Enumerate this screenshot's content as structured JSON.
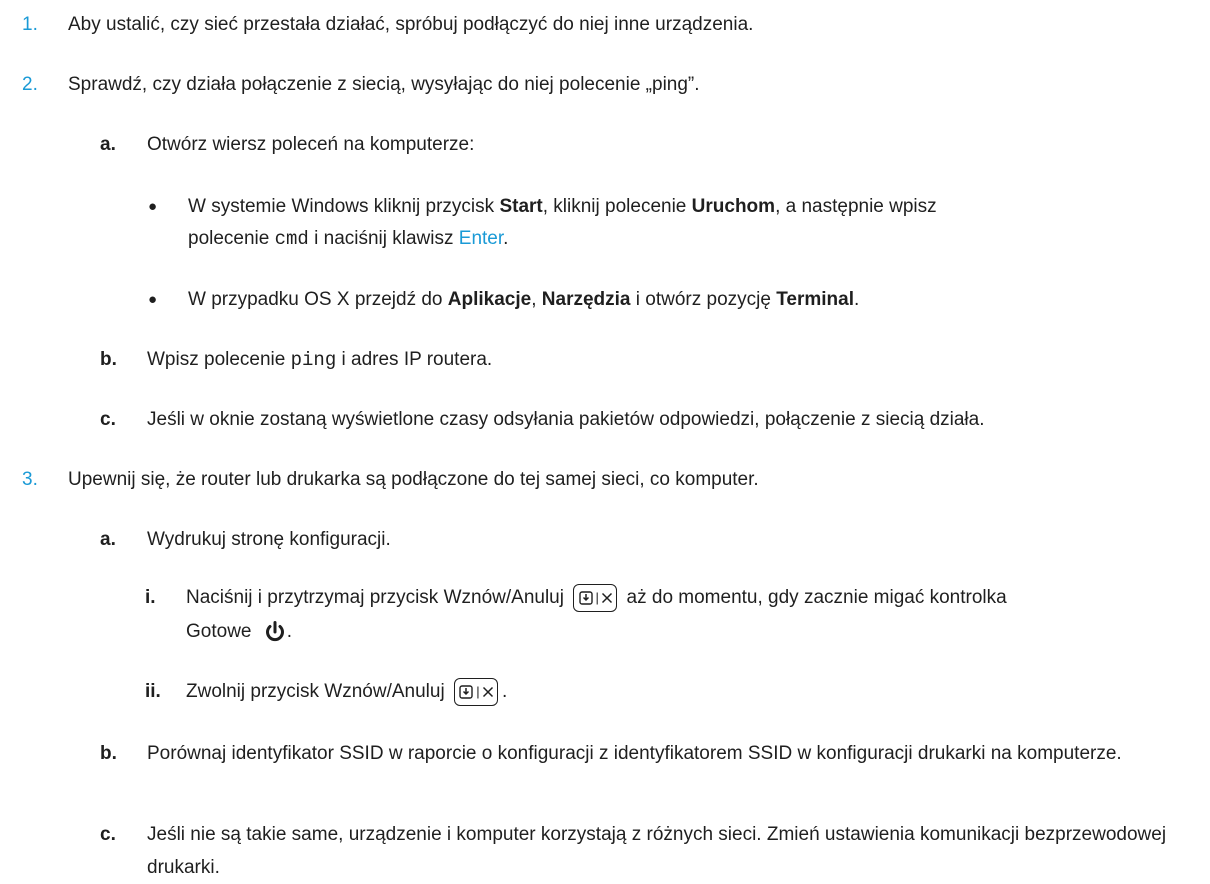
{
  "steps": [
    {
      "num": "1.",
      "text": "Aby ustalić, czy sieć przestała działać, spróbuj podłączyć do niej inne urządzenia."
    },
    {
      "num": "2.",
      "text": "Sprawdź, czy działa połączenie z siecią, wysyłając do niej polecenie „ping”.",
      "substeps": [
        {
          "letter": "a.",
          "text": "Otwórz wiersz poleceń na komputerze:",
          "bullets": {
            "win": {
              "t1": "W systemie Windows kliknij przycisk ",
              "b1": "Start",
              "t2": ", kliknij polecenie ",
              "b2": "Uruchom",
              "t3": ", a następnie wpisz",
              "t4": "polecenie ",
              "code": "cmd",
              "t5": " i naciśnij klawisz ",
              "key": "Enter",
              "t6": "."
            },
            "mac": {
              "t1": "W przypadku OS X przejdź do ",
              "b1": "Aplikacje",
              "t2": ", ",
              "b2": "Narzędzia",
              "t3": " i otwórz pozycję ",
              "b3": "Terminal",
              "t4": "."
            }
          }
        },
        {
          "letter": "b.",
          "t1": "Wpisz polecenie ",
          "code": "ping",
          "t2": " i adres IP routera."
        },
        {
          "letter": "c.",
          "text": "Jeśli w oknie zostaną wyświetlone czasy odsyłania pakietów odpowiedzi, połączenie z siecią działa."
        }
      ]
    },
    {
      "num": "3.",
      "text": "Upewnij się, że router lub drukarka są podłączone do tej samej sieci, co komputer.",
      "substeps": [
        {
          "letter": "a.",
          "text": "Wydrukuj stronę konfiguracji.",
          "romans": [
            {
              "num": "i.",
              "t1": "Naciśnij i przytrzymaj przycisk Wznów/Anuluj ",
              "t2": " aż do momentu, gdy zacznie migać kontrolka",
              "t3": "Gotowe "
            },
            {
              "num": "ii.",
              "t1": "Zwolnij przycisk Wznów/Anuluj ",
              "t2": "."
            }
          ]
        },
        {
          "letter": "b.",
          "text": "Porównaj identyfikator SSID w raporcie o konfiguracji z identyfikatorem SSID w konfiguracji drukarki na komputerze."
        },
        {
          "letter": "c.",
          "text": "Jeśli nie są takie same, urządzenie i komputer korzystają z różnych sieci. Zmień ustawienia komunikacji bezprzewodowej drukarki."
        }
      ]
    }
  ],
  "icons": {
    "resume_cancel": "resume-cancel-button-icon",
    "ready": "power-ready-icon"
  }
}
